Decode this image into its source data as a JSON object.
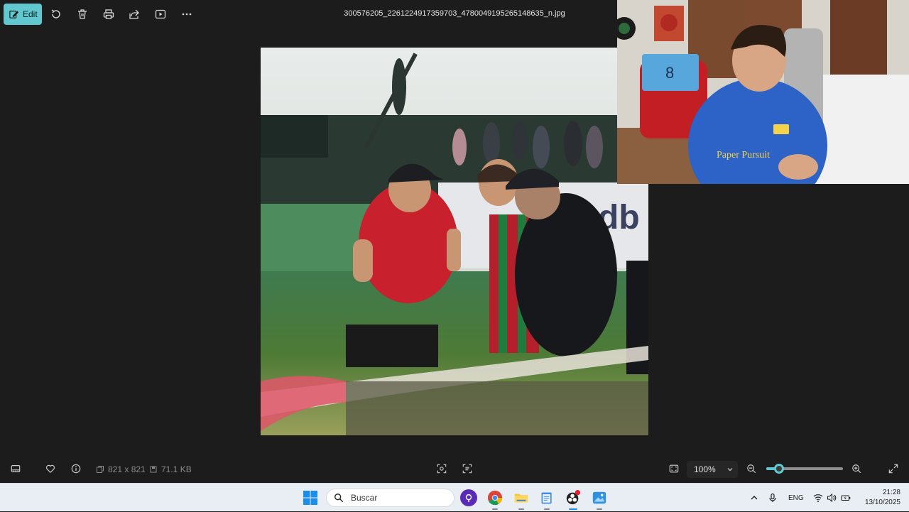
{
  "toolbar": {
    "edit_label": "Edit",
    "file_name": "300576205_2261224917359703_4780049195265148635_n.jpg",
    "icons": [
      "edit-icon",
      "rotate-icon",
      "delete-icon",
      "print-icon",
      "share-icon",
      "slideshow-icon",
      "more-icon"
    ]
  },
  "status": {
    "dimensions": "821 x 821",
    "file_size": "71.1 KB",
    "zoom_label": "100%",
    "zoom_level": 0.17
  },
  "taskbar": {
    "search_placeholder": "Buscar",
    "language": "ENG",
    "time": "21:28",
    "date": "13/10/2025",
    "apps": [
      "podcast-app-icon",
      "chrome-icon",
      "file-explorer-icon",
      "notepad-icon",
      "obs-icon",
      "photos-icon"
    ]
  },
  "colors": {
    "accent": "#62c8cf",
    "background": "#1c1c1c",
    "taskbar": "#e9eef4"
  },
  "webcam": {
    "shirt_text": "Paper Pursuit",
    "jersey_number": "8"
  }
}
